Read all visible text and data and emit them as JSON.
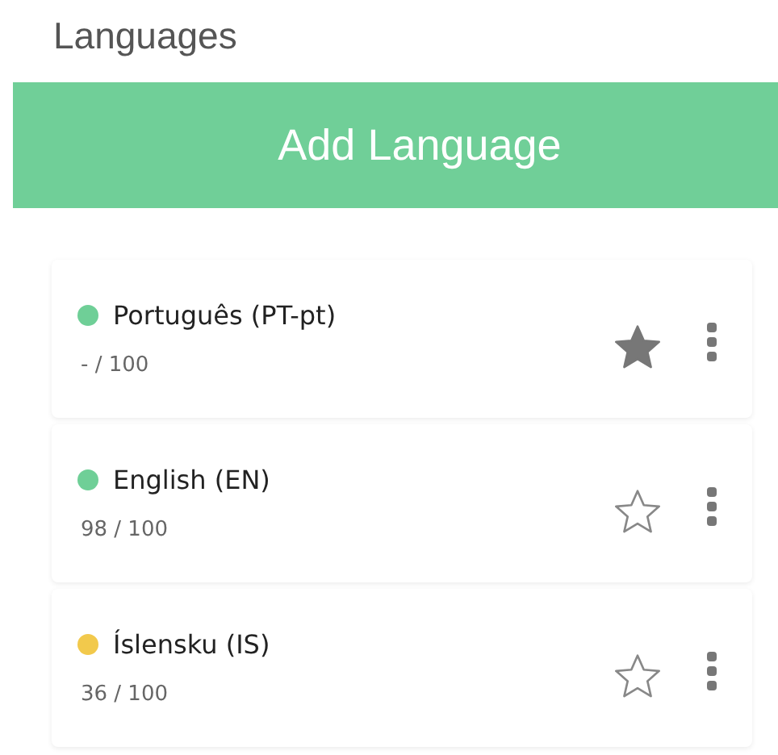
{
  "title": "Languages",
  "add_button": "Add Language",
  "languages": [
    {
      "name": "Português (PT-pt)",
      "color": "#6fcf97",
      "score": "- / 100",
      "starred": true
    },
    {
      "name": "English (EN)",
      "color": "#6fcf97",
      "score": "98 / 100",
      "starred": false
    },
    {
      "name": "Íslensku (IS)",
      "color": "#f2c94c",
      "score": "36 / 100",
      "starred": false
    }
  ]
}
